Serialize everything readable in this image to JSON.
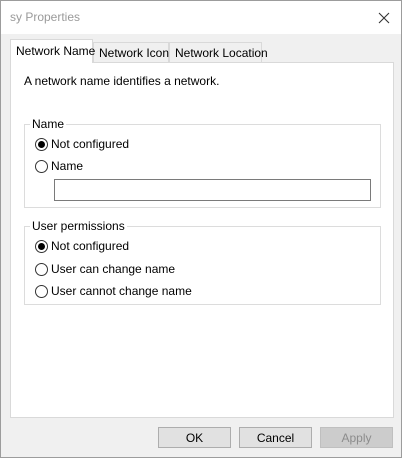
{
  "window": {
    "title": "sy Properties",
    "close_icon": "close-icon"
  },
  "tabs": [
    {
      "label": "Network Name",
      "active": true
    },
    {
      "label": "Network Icon",
      "active": false
    },
    {
      "label": "Network Location",
      "active": false
    }
  ],
  "panel": {
    "description": "A network name identifies a network.",
    "name_group": {
      "legend": "Name",
      "options": [
        {
          "label": "Not configured",
          "checked": true
        },
        {
          "label": "Name",
          "checked": false
        }
      ],
      "name_value": ""
    },
    "permissions_group": {
      "legend": "User permissions",
      "options": [
        {
          "label": "Not configured",
          "checked": true
        },
        {
          "label": "User can change name",
          "checked": false
        },
        {
          "label": "User cannot change name",
          "checked": false
        }
      ]
    }
  },
  "buttons": {
    "ok": "OK",
    "cancel": "Cancel",
    "apply": "Apply"
  }
}
